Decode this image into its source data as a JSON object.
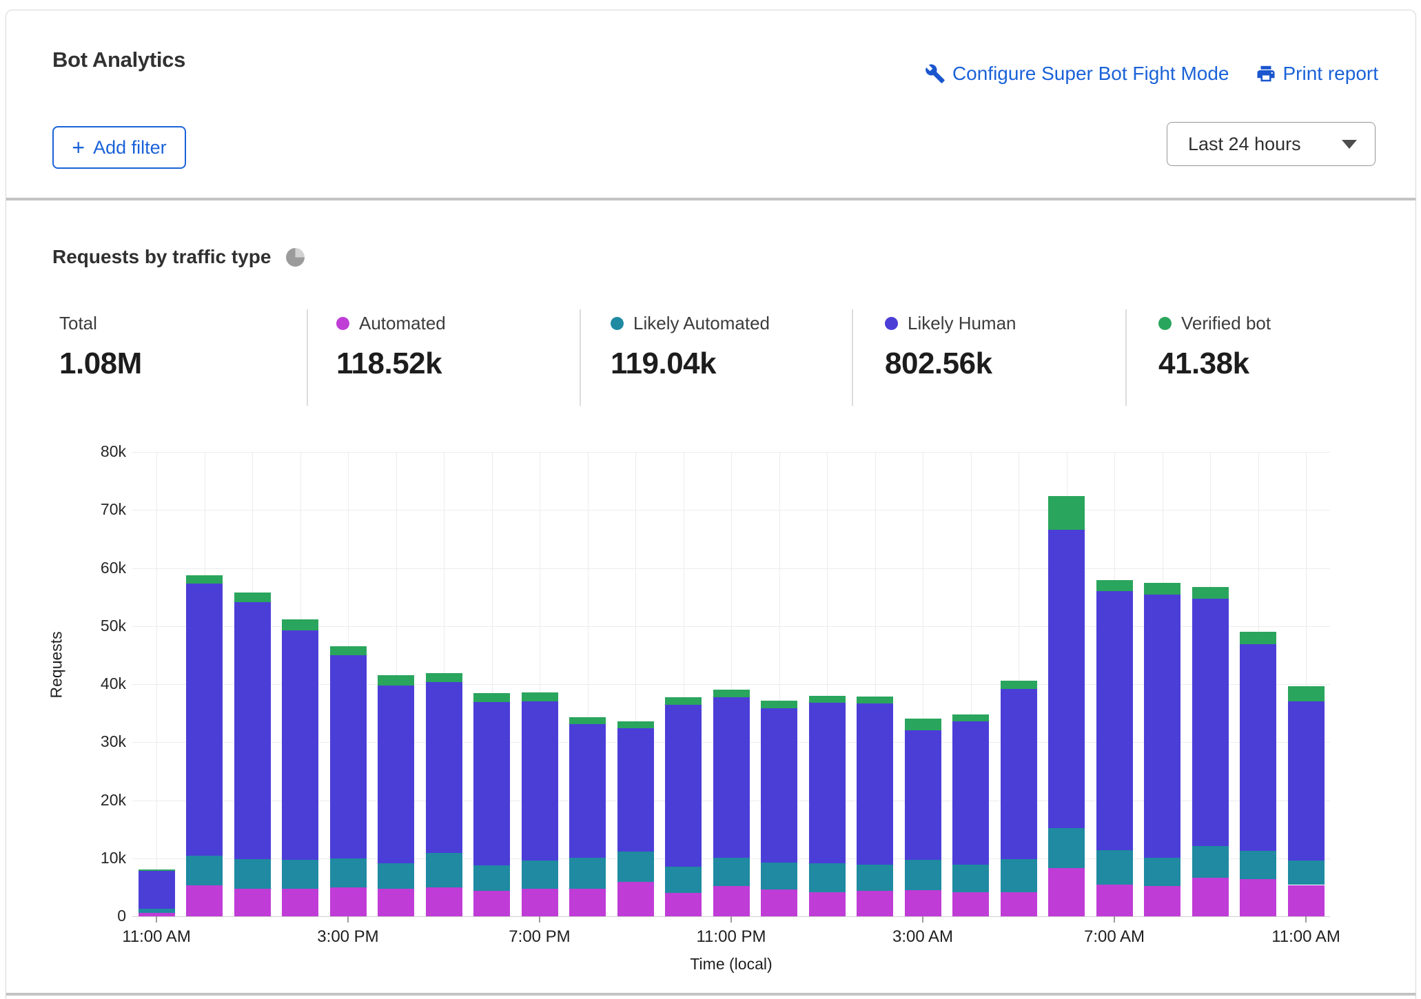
{
  "header": {
    "title": "Bot Analytics",
    "links": [
      {
        "label": "Configure Super Bot Fight Mode",
        "icon": "wrench-icon"
      },
      {
        "label": "Print report",
        "icon": "printer-icon"
      }
    ],
    "add_filter_plus": "+",
    "add_filter_label": "Add filter",
    "time_range": "Last 24 hours"
  },
  "section": {
    "title": "Requests by traffic type"
  },
  "stats": [
    {
      "label": "Total",
      "value": "1.08M",
      "dot": null
    },
    {
      "label": "Automated",
      "value": "118.52k",
      "dot": "#bf3dd6"
    },
    {
      "label": "Likely Automated",
      "value": "119.04k",
      "dot": "#1f8aa1"
    },
    {
      "label": "Likely Human",
      "value": "802.56k",
      "dot": "#4b3ed7"
    },
    {
      "label": "Verified bot",
      "value": "41.38k",
      "dot": "#2aa55d"
    }
  ],
  "chart_data": {
    "type": "bar",
    "stacked": true,
    "title": "Requests by traffic type",
    "xlabel": "Time (local)",
    "ylabel": "Requests",
    "unit": "thousands of requests",
    "ylim": [
      0,
      80000
    ],
    "grid": true,
    "y_ticks": [
      "0",
      "10k",
      "20k",
      "30k",
      "40k",
      "50k",
      "60k",
      "70k",
      "80k"
    ],
    "x_label_every": 4,
    "categories": [
      "11:00 AM",
      "12:00 PM",
      "1:00 PM",
      "2:00 PM",
      "3:00 PM",
      "4:00 PM",
      "5:00 PM",
      "6:00 PM",
      "7:00 PM",
      "8:00 PM",
      "9:00 PM",
      "10:00 PM",
      "11:00 PM",
      "12:00 AM",
      "1:00 AM",
      "2:00 AM",
      "3:00 AM",
      "4:00 AM",
      "5:00 AM",
      "6:00 AM",
      "7:00 AM",
      "8:00 AM",
      "9:00 AM",
      "10:00 AM",
      "11:00 AM"
    ],
    "series": [
      {
        "name": "Automated",
        "color": "#bf3dd6",
        "values": [
          0.6,
          5.4,
          4.8,
          4.7,
          5.0,
          4.7,
          5.0,
          4.4,
          4.8,
          4.7,
          5.9,
          4.0,
          5.2,
          4.6,
          4.2,
          4.4,
          4.5,
          4.1,
          4.2,
          8.3,
          5.5,
          5.2,
          6.7,
          6.4,
          5.4
        ]
      },
      {
        "name": "Likely Automated",
        "color": "#1f8aa1",
        "values": [
          0.7,
          5.0,
          5.0,
          5.0,
          5.0,
          4.4,
          5.9,
          4.4,
          4.8,
          5.4,
          5.2,
          4.6,
          4.9,
          4.6,
          4.9,
          4.5,
          5.2,
          4.8,
          5.6,
          6.9,
          5.9,
          4.9,
          5.4,
          4.9,
          4.2
        ]
      },
      {
        "name": "Likely Human",
        "color": "#4b3ed7",
        "values": [
          6.5,
          46.9,
          44.3,
          39.6,
          35.0,
          30.7,
          29.4,
          28.1,
          27.4,
          23.0,
          21.3,
          27.8,
          27.7,
          26.6,
          27.7,
          27.8,
          22.4,
          24.7,
          29.4,
          51.4,
          44.6,
          45.3,
          42.6,
          35.6,
          27.4
        ]
      },
      {
        "name": "Verified bot",
        "color": "#2aa55d",
        "values": [
          0.3,
          1.5,
          1.7,
          1.9,
          1.5,
          1.7,
          1.6,
          1.6,
          1.6,
          1.2,
          1.2,
          1.3,
          1.2,
          1.3,
          1.2,
          1.2,
          2.0,
          1.2,
          1.4,
          5.75,
          1.9,
          2.0,
          2.0,
          2.1,
          2.6
        ]
      }
    ],
    "totals": {
      "total": "1.08M",
      "automated": "118.52k",
      "likely_automated": "119.04k",
      "likely_human": "802.56k",
      "verified_bot": "41.38k"
    }
  }
}
